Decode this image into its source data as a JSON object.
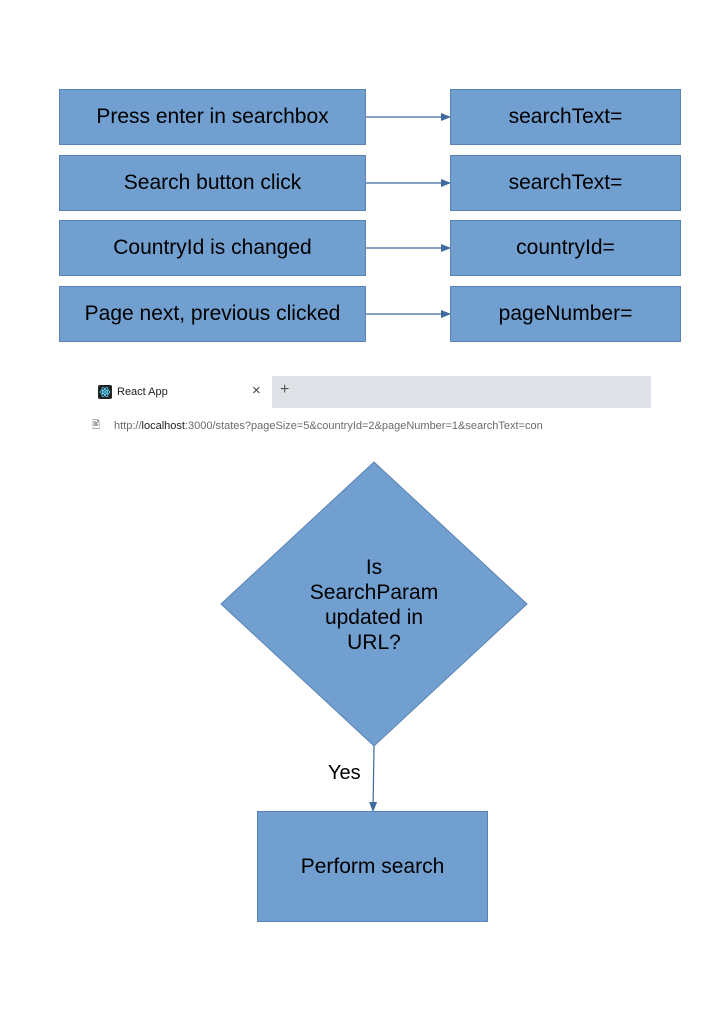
{
  "flow_rows": [
    {
      "trigger": "Press enter in searchbox",
      "param": "searchText="
    },
    {
      "trigger": "Search button click",
      "param": "searchText="
    },
    {
      "trigger": "CountryId is changed",
      "param": "countryId="
    },
    {
      "trigger": "Page next, previous clicked",
      "param": "pageNumber="
    }
  ],
  "browser": {
    "tab_title": "React App",
    "tab_close": "×",
    "new_tab": "+",
    "url_scheme": "http://",
    "url_host": "localhost",
    "url_rest": ":3000/states?pageSize=5&countryId=2&pageNumber=1&searchText=con"
  },
  "decision": {
    "question_lines": [
      "Is",
      "SearchParam",
      "updated in",
      "URL?"
    ],
    "yes_label": "Yes",
    "action": "Perform search"
  },
  "colors": {
    "box_fill": "#709fd0",
    "box_border": "#5a83b3",
    "arrow": "#3f6a9e"
  }
}
